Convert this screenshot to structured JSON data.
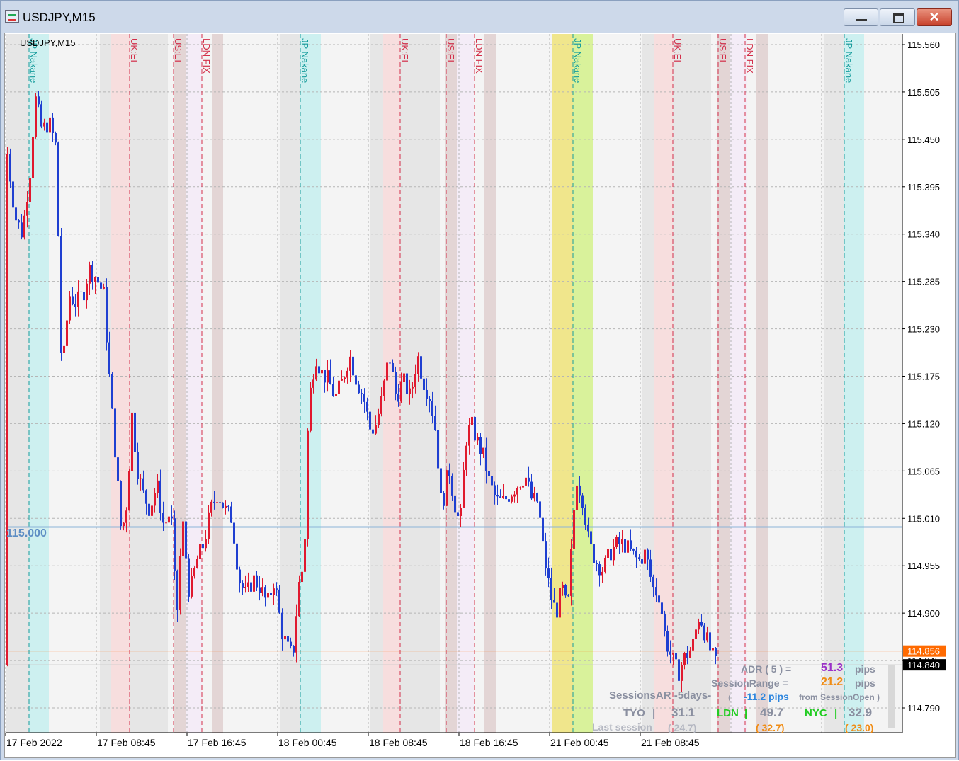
{
  "window": {
    "title": "USDJPY,M15",
    "minimize": "minimize",
    "maximize": "maximize",
    "close": "✕"
  },
  "chart": {
    "symbol_label": "USDJPY,M15",
    "price_levels": [
      "115.560",
      "115.505",
      "115.450",
      "115.395",
      "115.340",
      "115.285",
      "115.230",
      "115.175",
      "115.120",
      "115.065",
      "115.010",
      "114.955",
      "114.900",
      "114.845",
      "114.790"
    ],
    "price_range": [
      114.765,
      115.572
    ],
    "time_labels": [
      "17 Feb 2022",
      "17 Feb 08:45",
      "17 Feb 16:45",
      "18 Feb 00:45",
      "18 Feb 08:45",
      "18 Feb 16:45",
      "21 Feb 00:45",
      "21 Feb 08:45"
    ],
    "horizontal_line": {
      "label": "115.000",
      "price": 115.0,
      "color": "#8cb4d8"
    },
    "bid_price": {
      "label": "114.856",
      "price": 114.856,
      "color": "#ff6a00"
    },
    "ask_price": {
      "label": "114.840",
      "price": 114.84,
      "color": "#000000"
    },
    "colors": {
      "bull": "#e0192f",
      "bear": "#1f3fd1",
      "grid": "#b5b5b5",
      "jp_zone": "#cdf0f0",
      "uk_zone": "#f7dede",
      "gray_zone": "#e6e6e6",
      "brown_zone": "#e3d5d5",
      "lavender_zone": "#f4ecf7",
      "yellow_zone": "#f0e68c",
      "green_zone": "#d9f29b"
    },
    "session_markers": [
      {
        "label": "JP Nakane",
        "color": "#169c9c"
      },
      {
        "label": "UK:EI",
        "color": "#d32f4a"
      },
      {
        "label": "US:EI",
        "color": "#d32f4a"
      },
      {
        "label": "LDN FIX",
        "color": "#d32f4a"
      },
      {
        "label": "JP Nakane",
        "color": "#169c9c"
      },
      {
        "label": "UK:EI",
        "color": "#d32f4a"
      },
      {
        "label": "US:EI",
        "color": "#d32f4a"
      },
      {
        "label": "LDN FIX",
        "color": "#d32f4a"
      },
      {
        "label": "JP Nakane",
        "color": "#169c9c"
      },
      {
        "label": "UK:EI",
        "color": "#d32f4a"
      },
      {
        "label": "US:EI",
        "color": "#d32f4a"
      },
      {
        "label": "LDN FIX",
        "color": "#d32f4a"
      },
      {
        "label": "JP Nakane",
        "color": "#169c9c"
      }
    ]
  },
  "info_panel": {
    "adr_label": "ADR ( 5 ) =",
    "adr_value": "51.3",
    "adr_unit": "pips",
    "session_range_label": "SessionRange  =",
    "session_range_value": "21.2",
    "session_range_unit": "pips",
    "open_paren": "(",
    "from_open_value": "-11.2 pips",
    "from_open_text": "from SessionOpen )",
    "sessions_ar_label": "SessionsAR -5days-",
    "tyo_label": "TYO",
    "sep": "|",
    "tyo_value": "31.1",
    "ldn_label": "LDN",
    "ldn_value": "49.7",
    "nyc_label": "NYC",
    "nyc_value": "32.9",
    "last_session_label": "Last session",
    "tyo_last": "( 24.7)",
    "ldn_last": "( 32.7)",
    "nyc_last": "( 23.0)"
  }
}
